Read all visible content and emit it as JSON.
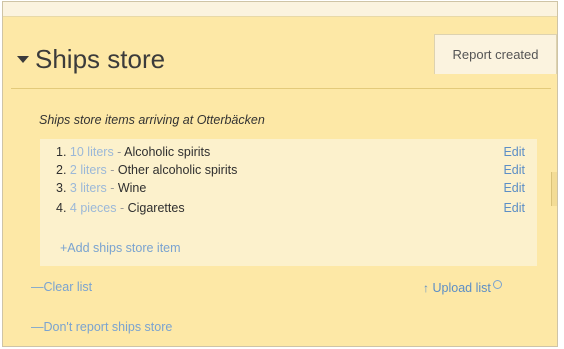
{
  "header": {
    "title": "Ships store",
    "status_badge": "Report created"
  },
  "section": {
    "title": "Ships store items arriving at Otterbäcken"
  },
  "items": [
    {
      "num": "1.",
      "qty": "10 liters",
      "sep": " - ",
      "name": "Alcoholic spirits",
      "edit": "Edit"
    },
    {
      "num": "2.",
      "qty": "2 liters",
      "sep": " - ",
      "name": "Other alcoholic spirits",
      "edit": "Edit"
    },
    {
      "num": "3.",
      "qty": "3 liters",
      "sep": " - ",
      "name": "Wine",
      "edit": "Edit"
    },
    {
      "num": "4.",
      "qty": "4 pieces",
      "sep": " - ",
      "name": "Cigarettes",
      "edit": "Edit"
    }
  ],
  "actions": {
    "add_item": "+Add ships store item",
    "clear_list": "—Clear list",
    "upload_list": "Upload list",
    "upload_arrow": "↑",
    "dont_report": "—Don't report ships store"
  },
  "colors": {
    "panel_bg": "#fde8a6",
    "list_bg": "#fcf1cc",
    "link": "#5c8ec6"
  }
}
